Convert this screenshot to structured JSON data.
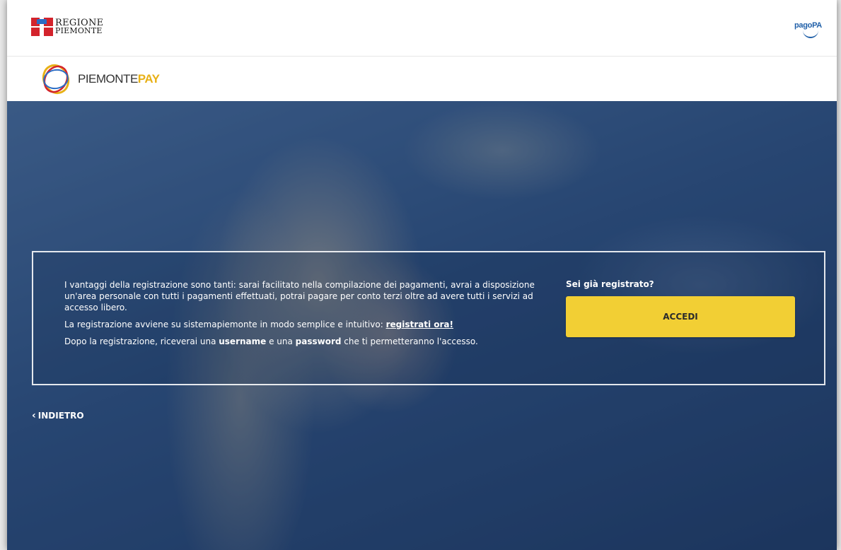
{
  "header": {
    "regione_line1": "REGIONE",
    "regione_line2": "PIEMONTE",
    "pagopa_label": "pagoPA"
  },
  "brand": {
    "name_part1": "PIEMONTE",
    "name_part2": "PAY",
    "colors": {
      "accent": "#e8b117",
      "logo_ring_colors": [
        "#e8b117",
        "#d3232c",
        "#2b6cc4"
      ]
    }
  },
  "info": {
    "paragraph1": "I vantaggi della registrazione sono tanti: sarai facilitato nella compilazione dei pagamenti, avrai a disposizione un'area personale con tutti i pagamenti effettuati, potrai pagare per conto terzi oltre ad avere tutti i servizi ad accesso libero.",
    "paragraph2_prefix": "La registrazione avviene su sistemapiemonte in modo semplice e intuitivo: ",
    "register_link": "registrati ora!",
    "paragraph3_a": "Dopo la registrazione, riceverai una ",
    "paragraph3_username": "username",
    "paragraph3_b": " e una ",
    "paragraph3_password": "password",
    "paragraph3_c": " che ti permetteranno l'accesso."
  },
  "login": {
    "title": "Sei già registrato?",
    "button_label": "ACCEDI",
    "button_color": "#f2cf34"
  },
  "nav": {
    "back_icon": "chevron-left-icon",
    "back_label": "INDIETRO"
  }
}
